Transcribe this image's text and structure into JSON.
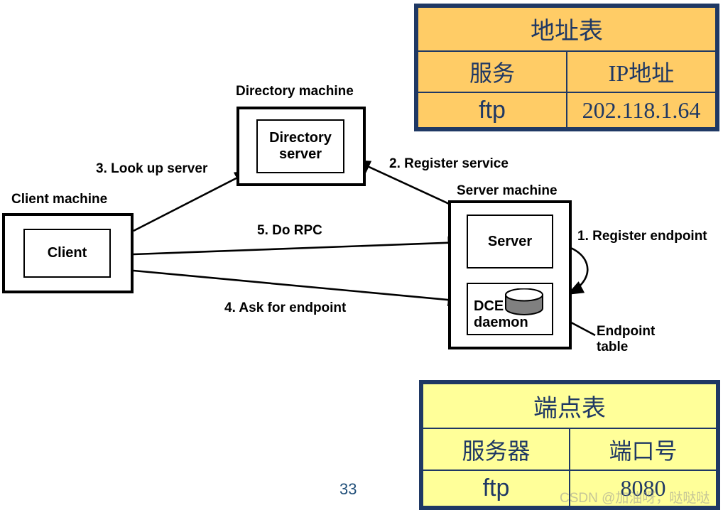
{
  "slide": {
    "page_number": "33",
    "watermark": "CSDN @加油呀，哒哒哒"
  },
  "diagram": {
    "machines": [
      {
        "id": "client-machine",
        "caption": "Client machine",
        "inner_label": "Client"
      },
      {
        "id": "directory-machine",
        "caption": "Directory machine",
        "inner_label": "Directory\nserver"
      },
      {
        "id": "server-machine",
        "caption": "Server machine",
        "inner_label_1": "Server",
        "inner_label_2": "DCE\ndaemon"
      }
    ],
    "client_machine_caption": "Client machine",
    "client_label": "Client",
    "directory_machine_caption": "Directory machine",
    "directory_label_line1": "Directory",
    "directory_label_line2": "server",
    "server_machine_caption": "Server machine",
    "server_label": "Server",
    "dce_label_line1": "DCE",
    "dce_label_line2": "daemon",
    "endpoint_table_label_line1": "Endpoint",
    "endpoint_table_label_line2": "table",
    "steps": [
      {
        "id": "step-1",
        "label": "1. Register endpoint"
      },
      {
        "id": "step-2",
        "label": "2. Register service"
      },
      {
        "id": "step-3",
        "label": "3. Look up server"
      },
      {
        "id": "step-4",
        "label": "4. Ask for endpoint"
      },
      {
        "id": "step-5",
        "label": "5. Do RPC"
      }
    ]
  },
  "address_table": {
    "title": "地址表",
    "headers": [
      "服务",
      "IP地址"
    ],
    "rows": [
      [
        "ftp",
        "202.118.1.64"
      ]
    ],
    "fill": "#FFCC66",
    "border": "#1F3864"
  },
  "endpoint_table": {
    "title": "端点表",
    "headers": [
      "服务器",
      "端口号"
    ],
    "rows": [
      [
        "ftp",
        "8080"
      ]
    ],
    "fill": "#FFFF99",
    "border": "#1F3864"
  }
}
